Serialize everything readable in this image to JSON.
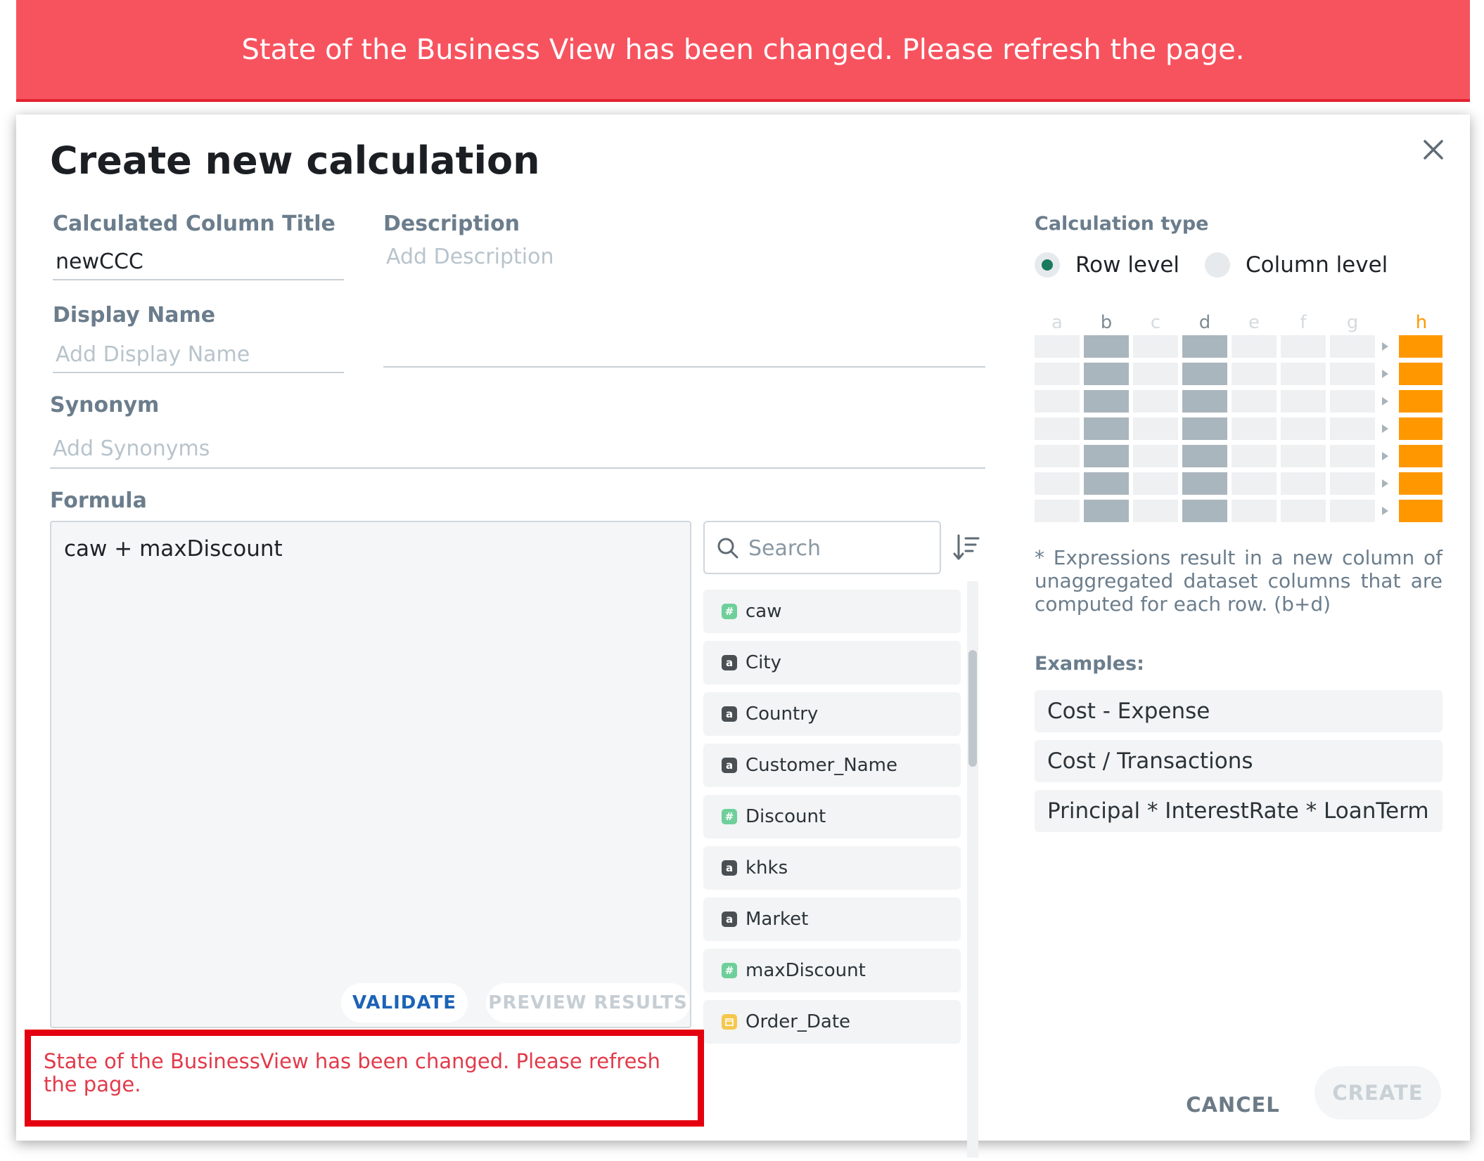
{
  "banner": {
    "message": "State of the Business View has been changed. Please refresh the page."
  },
  "modal": {
    "title": "Create new calculation",
    "fields": {
      "title_label": "Calculated Column Title",
      "title_value": "newCCC",
      "description_label": "Description",
      "description_placeholder": "Add Description",
      "display_name_label": "Display Name",
      "display_name_placeholder": "Add Display Name",
      "synonym_label": "Synonym",
      "synonym_placeholder": "Add Synonyms"
    },
    "formula": {
      "label": "Formula",
      "value": "caw + maxDiscount",
      "validate_label": "VALIDATE",
      "preview_label": "PREVIEW RESULTS"
    },
    "search": {
      "placeholder": "Search"
    },
    "columns": [
      {
        "name": "caw",
        "type": "numeric",
        "badge": "#"
      },
      {
        "name": "City",
        "type": "text",
        "badge": "a"
      },
      {
        "name": "Country",
        "type": "text",
        "badge": "a"
      },
      {
        "name": "Customer_Name",
        "type": "text",
        "badge": "a"
      },
      {
        "name": "Discount",
        "type": "numeric",
        "badge": "#"
      },
      {
        "name": "khks",
        "type": "text",
        "badge": "a"
      },
      {
        "name": "Market",
        "type": "text",
        "badge": "a"
      },
      {
        "name": "maxDiscount",
        "type": "numeric",
        "badge": "#"
      },
      {
        "name": "Order_Date",
        "type": "date",
        "badge": ""
      }
    ],
    "error": "State of the BusinessView has been changed. Please refresh the page.",
    "calc_type": {
      "label": "Calculation type",
      "options": [
        {
          "label": "Row level",
          "selected": true
        },
        {
          "label": "Column level",
          "selected": false
        }
      ],
      "grid_columns": [
        "a",
        "b",
        "c",
        "d",
        "e",
        "f",
        "g",
        "h"
      ],
      "highlighted_columns": [
        "b",
        "d"
      ],
      "result_column": "h",
      "description": "* Expressions result in a new column of unaggregated dataset columns that are computed for each row. (b+d)"
    },
    "examples": {
      "label": "Examples:",
      "items": [
        "Cost - Expense",
        "Cost / Transactions",
        "Principal * InterestRate * LoanTerm"
      ]
    },
    "actions": {
      "cancel_label": "CANCEL",
      "create_label": "CREATE"
    }
  },
  "colors": {
    "banner_bg": "#f7535f",
    "numeric_badge": "#6ecf9a",
    "text_badge": "#4a4f54",
    "date_badge": "#f5c84c",
    "highlight_gray": "#aab6bd",
    "result_orange": "#ff9800",
    "radio_selected": "#1a7a5e",
    "validate_blue": "#1c63b7",
    "error_red": "#e23a4a"
  }
}
